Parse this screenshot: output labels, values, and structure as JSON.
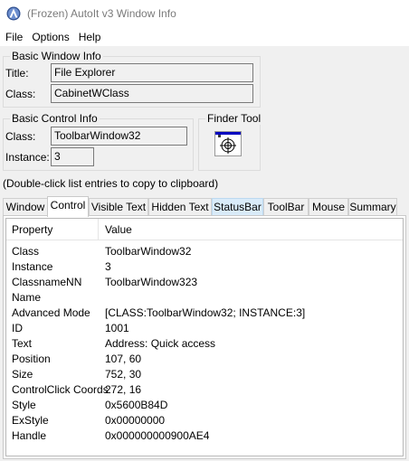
{
  "window": {
    "title": "(Frozen) AutoIt v3 Window Info",
    "icon": "autoit-icon"
  },
  "menu": [
    "File",
    "Options",
    "Help"
  ],
  "basic_window_info": {
    "legend": "Basic Window Info",
    "title_label": "Title:",
    "title_value": "File Explorer",
    "class_label": "Class:",
    "class_value": "CabinetWClass"
  },
  "basic_control_info": {
    "legend": "Basic Control Info",
    "class_label": "Class:",
    "class_value": "ToolbarWindow32",
    "instance_label": "Instance:",
    "instance_value": "3"
  },
  "finder_tool": {
    "legend": "Finder Tool",
    "icon": "crosshair-target-icon"
  },
  "hint": "(Double-click list entries to copy to clipboard)",
  "tabs": [
    {
      "label": "Window"
    },
    {
      "label": "Control",
      "active": true
    },
    {
      "label": "Visible Text"
    },
    {
      "label": "Hidden Text"
    },
    {
      "label": "StatusBar",
      "hot": true
    },
    {
      "label": "ToolBar"
    },
    {
      "label": "Mouse"
    },
    {
      "label": "Summary"
    }
  ],
  "list": {
    "col_property": "Property",
    "col_value": "Value",
    "rows": [
      {
        "property": "Class",
        "value": "ToolbarWindow32"
      },
      {
        "property": "Instance",
        "value": "3"
      },
      {
        "property": "ClassnameNN",
        "value": "ToolbarWindow323"
      },
      {
        "property": "Name",
        "value": ""
      },
      {
        "property": "Advanced Mode",
        "value": "[CLASS:ToolbarWindow32; INSTANCE:3]"
      },
      {
        "property": "ID",
        "value": "1001"
      },
      {
        "property": "Text",
        "value": "Address: Quick access"
      },
      {
        "property": "Position",
        "value": "107, 60"
      },
      {
        "property": "Size",
        "value": "752, 30"
      },
      {
        "property": "ControlClick Coords",
        "value": "272, 16"
      },
      {
        "property": "Style",
        "value": "0x5600B84D"
      },
      {
        "property": "ExStyle",
        "value": "0x00000000"
      },
      {
        "property": "Handle",
        "value": "0x000000000900AE4"
      }
    ]
  },
  "colors": {
    "tab_hot": "#d9ebf9",
    "title_text": "#7a7a7a",
    "finder_bar": "#0000c0"
  }
}
